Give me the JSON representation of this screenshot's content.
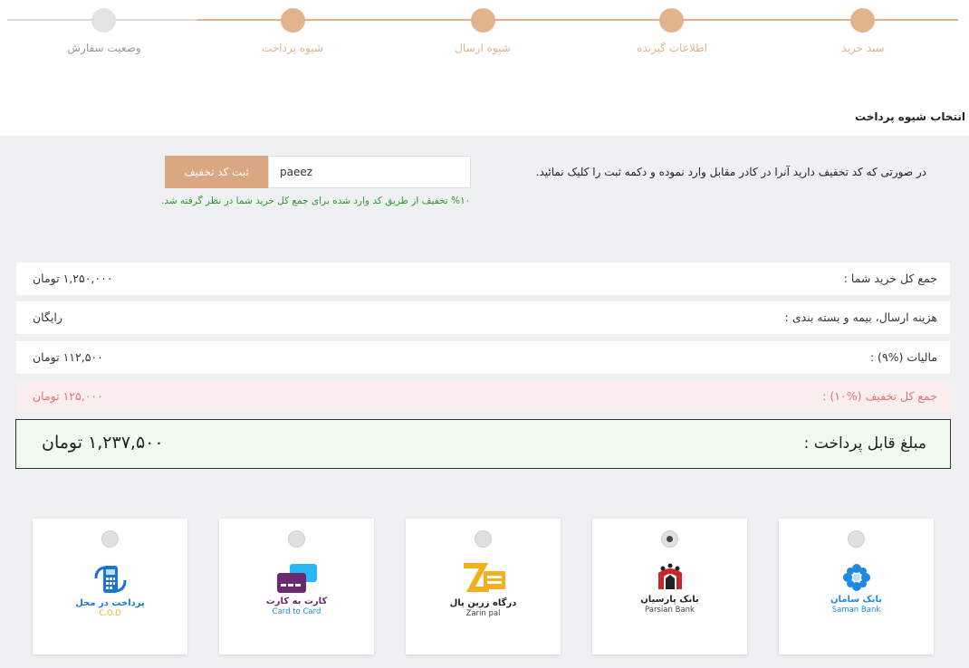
{
  "steps": [
    {
      "label": "سبد خرید",
      "state": "done"
    },
    {
      "label": "اطلاعات گیرنده",
      "state": "done"
    },
    {
      "label": "شیوه ارسال",
      "state": "done"
    },
    {
      "label": "شیوه پرداخت",
      "state": "done"
    },
    {
      "label": "وضعیت سفارش",
      "state": "pending"
    }
  ],
  "section_title": "انتخاب شیوه پرداخت",
  "discount": {
    "instruction": "در صورتی که کد تخفیف دارید آنرا در کادر مقابل وارد نموده و دکمه ثبت را کلیک نمائید.",
    "input_value": "paeez",
    "button_label": "ثبت کد تخفیف",
    "success_message": "%۱۰ تخفیف از طریق کد وارد شده برای جمع کل خرید شما در نظر گرفته شد."
  },
  "summary": {
    "total_label": "جمع کل خرید شما :",
    "total_value": "۱,۲۵۰,۰۰۰ تومان",
    "shipping_label": "هزینه ارسال، بیمه و بسته بندی :",
    "shipping_value": "رایگان",
    "tax_label": "مالیات (%۹) :",
    "tax_value": "۱۱۲,۵۰۰ تومان",
    "discount_label": "جمع کل تخفیف (%۱۰) :",
    "discount_value": "۱۲۵,۰۰۰ تومان",
    "payable_label": "مبلغ قابل پرداخت :",
    "payable_value": "۱,۲۳۷,۵۰۰ تومان"
  },
  "payment_methods": [
    {
      "title": "بانک سامان",
      "subtitle": "Saman Bank",
      "selected": false
    },
    {
      "title": "بانک پارسیان",
      "subtitle": "Parsian Bank",
      "selected": true
    },
    {
      "title": "درگاه زرین پال",
      "subtitle": "Zarin pal",
      "selected": false
    },
    {
      "title": "کارت به کارت",
      "subtitle": "Card to Card",
      "selected": false
    },
    {
      "title": "پرداخت در محل",
      "subtitle": "C.O.D",
      "selected": false
    }
  ],
  "colors": {
    "accent": "#e2b48e",
    "success": "#2c9a2c",
    "discount": "#e57373",
    "saman": "#1e88e5",
    "parsian": "#c62828",
    "zarinpal": "#f2b01e",
    "card": "#6a2b6e",
    "cod": "#1976d2"
  }
}
